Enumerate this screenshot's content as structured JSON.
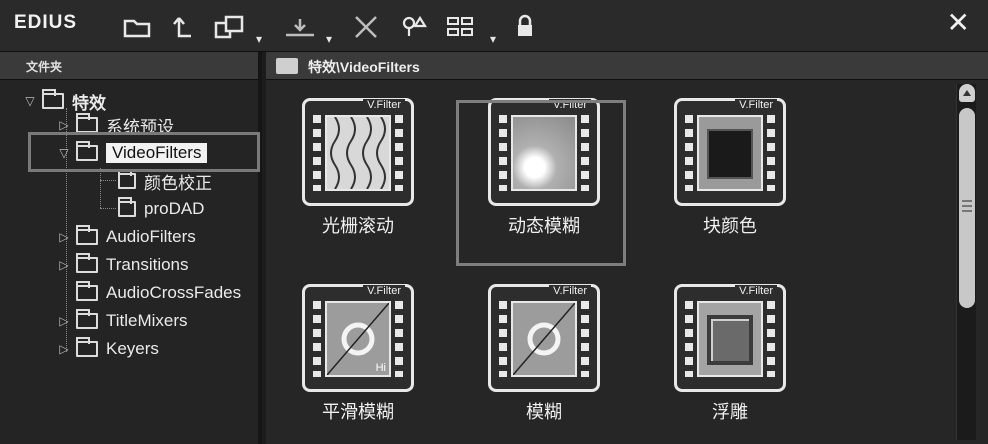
{
  "app": {
    "title": "EDIUS",
    "close_glyph": "✕"
  },
  "toolbar": {
    "icons": [
      "new-folder-icon",
      "up-folder-icon",
      "copy-icon",
      "dropdown-chevron-icon",
      "import-icon",
      "dropdown-chevron-icon",
      "delete-icon",
      "properties-icon",
      "view-toggle-icon",
      "dropdown-chevron-icon",
      "lock-icon"
    ]
  },
  "folder_pane": {
    "header": "文件夹",
    "tree": [
      {
        "label": "特效",
        "expanded": true,
        "level": 0
      },
      {
        "label": "系统预设",
        "level": 1
      },
      {
        "label": "VideoFilters",
        "level": 1,
        "selected": true
      },
      {
        "label": "颜色校正",
        "level": 2
      },
      {
        "label": "proDAD",
        "level": 2
      },
      {
        "label": "AudioFilters",
        "level": 1
      },
      {
        "label": "Transitions",
        "level": 1
      },
      {
        "label": "AudioCrossFades",
        "level": 1
      },
      {
        "label": "TitleMixers",
        "level": 1
      },
      {
        "label": "Keyers",
        "level": 1
      }
    ]
  },
  "content": {
    "path": "特效\\VideoFilters",
    "tile_tag": "V.Filter",
    "tiles": [
      {
        "label": "光栅滚动",
        "thumb": "waves"
      },
      {
        "label": "动态模糊",
        "thumb": "blur",
        "selected": true
      },
      {
        "label": "块颜色",
        "thumb": "block"
      },
      {
        "label": "平滑模糊",
        "thumb": "smooth",
        "badge": "Hi"
      },
      {
        "label": "模糊",
        "thumb": "mblur"
      },
      {
        "label": "浮雕",
        "thumb": "emboss"
      }
    ]
  },
  "colors": {
    "background": "#1c1c1c",
    "panel": "#262626",
    "header": "#3a3a3a",
    "selection_outline": "#7e7e7e"
  }
}
